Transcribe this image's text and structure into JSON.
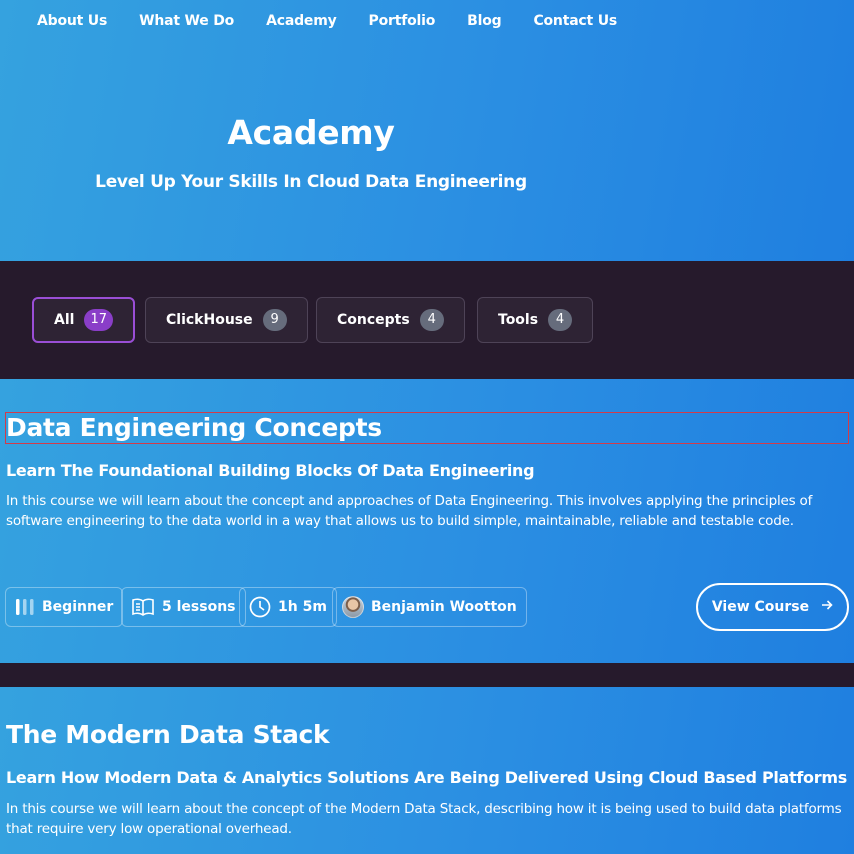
{
  "nav": {
    "items": [
      {
        "label": "About Us"
      },
      {
        "label": "What We Do"
      },
      {
        "label": "Academy"
      },
      {
        "label": "Portfolio"
      },
      {
        "label": "Blog"
      },
      {
        "label": "Contact Us"
      }
    ]
  },
  "hero": {
    "title": "Academy",
    "subtitle": "Level Up Your Skills In Cloud Data Engineering"
  },
  "filters": [
    {
      "label": "All",
      "count": "17",
      "active": true
    },
    {
      "label": "ClickHouse",
      "count": "9",
      "active": false
    },
    {
      "label": "Concepts",
      "count": "4",
      "active": false
    },
    {
      "label": "Tools",
      "count": "4",
      "active": false
    }
  ],
  "courses": [
    {
      "title": "Data Engineering Concepts",
      "subtitle": "Learn The Foundational Building Blocks Of Data Engineering",
      "description": "In this course we will learn about the concept and approaches of Data Engineering. This involves applying the principles of software engineering to the data world in a way that allows us to build simple, maintainable, reliable and testable code.",
      "level": "Beginner",
      "lessons": "5 lessons",
      "duration": "1h 5m",
      "author": "Benjamin Wootton",
      "cta": "View Course"
    },
    {
      "title": "The Modern Data Stack",
      "subtitle": "Learn How Modern Data & Analytics Solutions Are Being Delivered Using Cloud Based Platforms",
      "description": "In this course we will learn about the concept of the Modern Data Stack, describing how it is being used to build data platforms that require very low operational overhead."
    }
  ],
  "icons": {
    "level": "level-bars-icon",
    "lessons": "book-icon",
    "duration": "clock-icon",
    "cta": "arrow-right-icon"
  },
  "colors": {
    "hero_start": "#35a2df",
    "hero_end": "#1f7fe0",
    "dark_band": "#261a2c",
    "active_border": "#9a4ed6",
    "active_badge": "#8a3ec8",
    "badge": "#666c7c"
  }
}
